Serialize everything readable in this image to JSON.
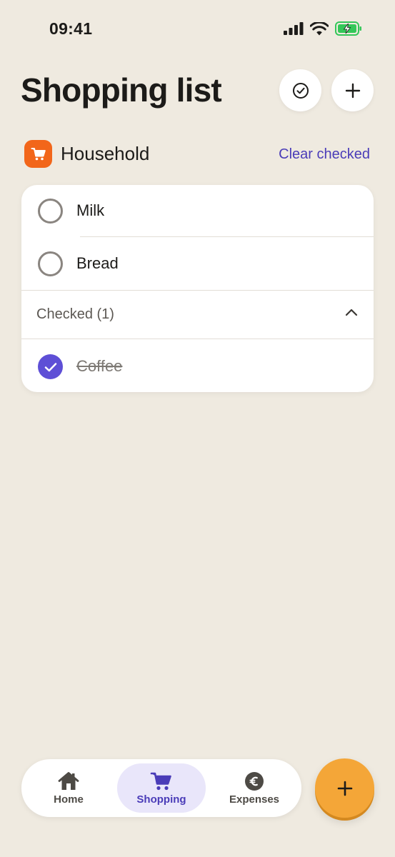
{
  "status_bar": {
    "time": "09:41",
    "battery_color": "#34C759"
  },
  "header": {
    "title": "Shopping list",
    "check_button_icon": "check-circle-icon",
    "add_button_icon": "plus-icon"
  },
  "group": {
    "name": "Household",
    "icon": "cart-icon",
    "icon_color": "#F2661A",
    "clear_label": "Clear checked"
  },
  "items": [
    {
      "label": "Milk",
      "checked": false
    },
    {
      "label": "Bread",
      "checked": false
    }
  ],
  "checked_section": {
    "label": "Checked (1)",
    "expanded": true,
    "items": [
      {
        "label": "Coffee",
        "checked": true
      }
    ]
  },
  "tabs": [
    {
      "label": "Home",
      "icon": "home-icon",
      "active": false
    },
    {
      "label": "Shopping",
      "icon": "cart-icon",
      "active": true
    },
    {
      "label": "Expenses",
      "icon": "euro-icon",
      "active": false
    }
  ],
  "fab": {
    "icon": "plus-icon",
    "color": "#F4A638"
  },
  "colors": {
    "accent": "#5E4FD6",
    "link": "#4A3CB8",
    "background": "#EFEAE0"
  }
}
